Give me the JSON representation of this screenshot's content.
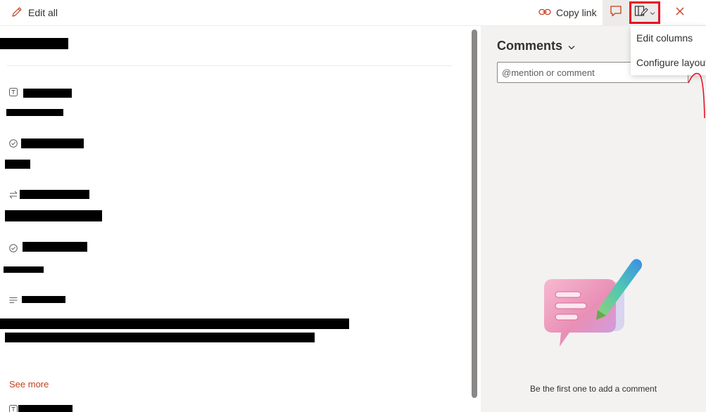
{
  "toolbar": {
    "edit_all_label": "Edit all",
    "copy_link_label": "Copy link"
  },
  "layout_menu": {
    "items": [
      {
        "label": "Edit columns"
      },
      {
        "label": "Configure layout"
      }
    ]
  },
  "comments": {
    "title": "Comments",
    "placeholder": "@mention or comment",
    "empty_state": "Be the first one to add a comment"
  },
  "form": {
    "see_more_label": "See more"
  },
  "icons": {
    "edit": "pencil-icon",
    "link": "link-icon",
    "comment": "comment-icon",
    "layout": "layout-edit-icon",
    "close": "close-icon",
    "chevron": "chevron-down-icon",
    "text_field": "text-field-icon",
    "choice_field": "check-circle-icon",
    "lookup_field": "swap-icon",
    "multiline_field": "multiline-text-icon"
  },
  "colors": {
    "accent": "#c43e1c",
    "highlight": "#e81123",
    "pane_bg": "#f3f2f1"
  }
}
